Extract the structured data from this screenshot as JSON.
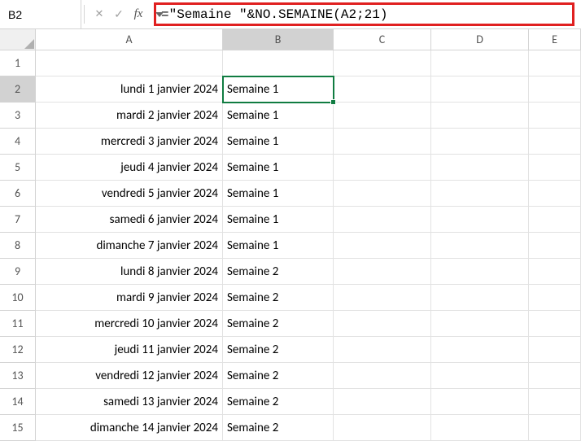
{
  "nameBox": "B2",
  "formula": "=\"Semaine \"&NO.SEMAINE(A2;21)",
  "columns": [
    {
      "label": "A",
      "cls": "col-A"
    },
    {
      "label": "B",
      "cls": "col-B",
      "selected": true
    },
    {
      "label": "C",
      "cls": "col-C"
    },
    {
      "label": "D",
      "cls": "col-D"
    },
    {
      "label": "E",
      "cls": "col-E"
    }
  ],
  "activeCell": {
    "row": 2,
    "col": "B"
  },
  "rows": [
    {
      "n": 1,
      "A": "",
      "B": ""
    },
    {
      "n": 2,
      "A": "lundi 1 janvier 2024",
      "B": "Semaine 1",
      "selected": true
    },
    {
      "n": 3,
      "A": "mardi 2 janvier 2024",
      "B": "Semaine 1"
    },
    {
      "n": 4,
      "A": "mercredi 3 janvier 2024",
      "B": "Semaine 1"
    },
    {
      "n": 5,
      "A": "jeudi 4 janvier 2024",
      "B": "Semaine 1"
    },
    {
      "n": 6,
      "A": "vendredi 5 janvier 2024",
      "B": "Semaine 1"
    },
    {
      "n": 7,
      "A": "samedi 6 janvier 2024",
      "B": "Semaine 1"
    },
    {
      "n": 8,
      "A": "dimanche 7 janvier 2024",
      "B": "Semaine 1"
    },
    {
      "n": 9,
      "A": "lundi 8 janvier 2024",
      "B": "Semaine 2"
    },
    {
      "n": 10,
      "A": "mardi 9 janvier 2024",
      "B": "Semaine 2"
    },
    {
      "n": 11,
      "A": "mercredi 10 janvier 2024",
      "B": "Semaine 2"
    },
    {
      "n": 12,
      "A": "jeudi 11 janvier 2024",
      "B": "Semaine 2"
    },
    {
      "n": 13,
      "A": "vendredi 12 janvier 2024",
      "B": "Semaine 2"
    },
    {
      "n": 14,
      "A": "samedi 13 janvier 2024",
      "B": "Semaine 2"
    },
    {
      "n": 15,
      "A": "dimanche 14 janvier 2024",
      "B": "Semaine 2"
    }
  ]
}
